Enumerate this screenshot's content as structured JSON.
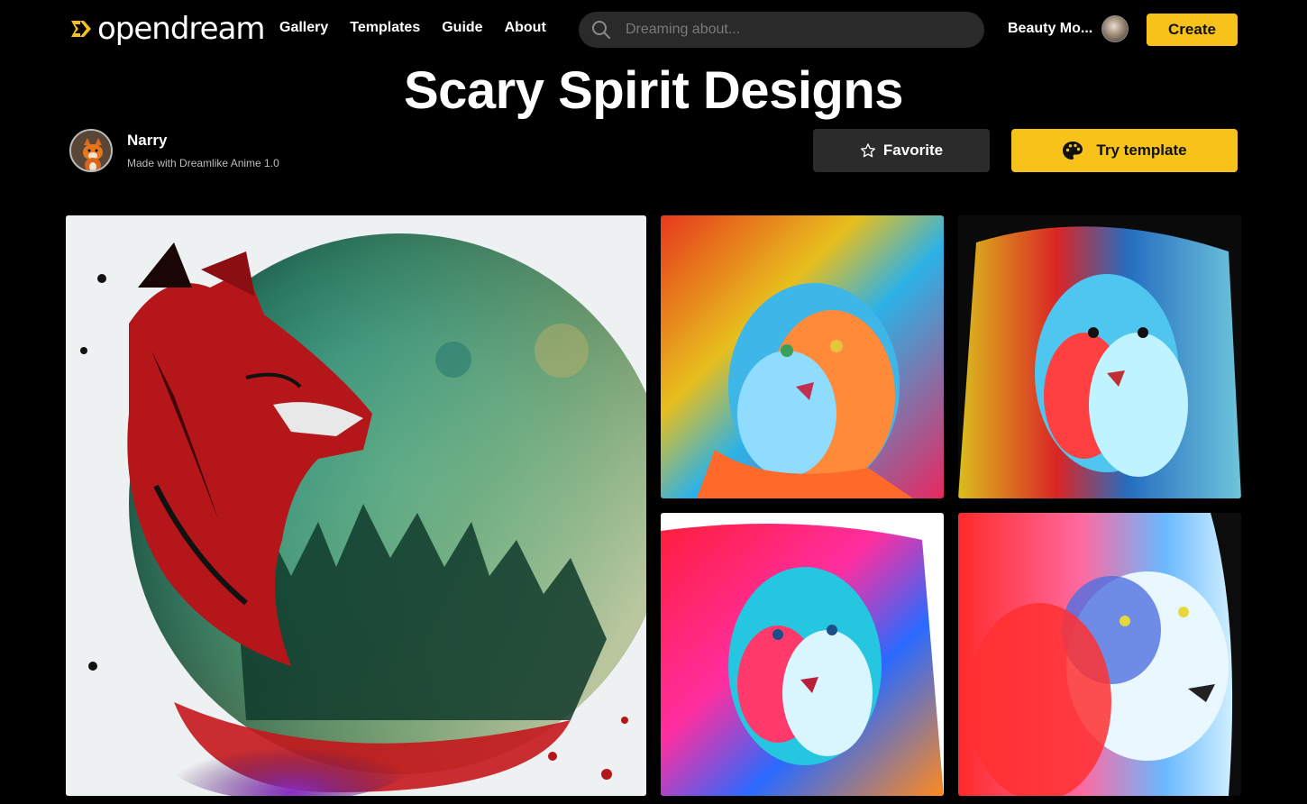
{
  "header": {
    "logo_text": "opendream",
    "nav": [
      "Gallery",
      "Templates",
      "Guide",
      "About"
    ],
    "search_placeholder": "Dreaming about...",
    "user_name": "Beauty Mo...",
    "create_label": "Create"
  },
  "page": {
    "title": "Scary Spirit Designs",
    "author_name": "Narry",
    "author_subtitle": "Made with Dreamlike Anime 1.0",
    "favorite_label": "Favorite",
    "try_label": "Try template"
  },
  "colors": {
    "accent": "#f7c21a",
    "background": "#000000",
    "secondary_button": "#2b2b2b"
  },
  "icons": {
    "logo": "opendream-logo-icon",
    "search": "search-icon",
    "favorite": "star-icon",
    "try": "palette-icon"
  },
  "gallery": {
    "images": [
      {
        "subject": "red fox with green moon watercolor"
      },
      {
        "subject": "colorful lion portrait"
      },
      {
        "subject": "colorful lion portrait"
      },
      {
        "subject": "colorful lion portrait"
      },
      {
        "subject": "colorful lion portrait"
      }
    ]
  }
}
